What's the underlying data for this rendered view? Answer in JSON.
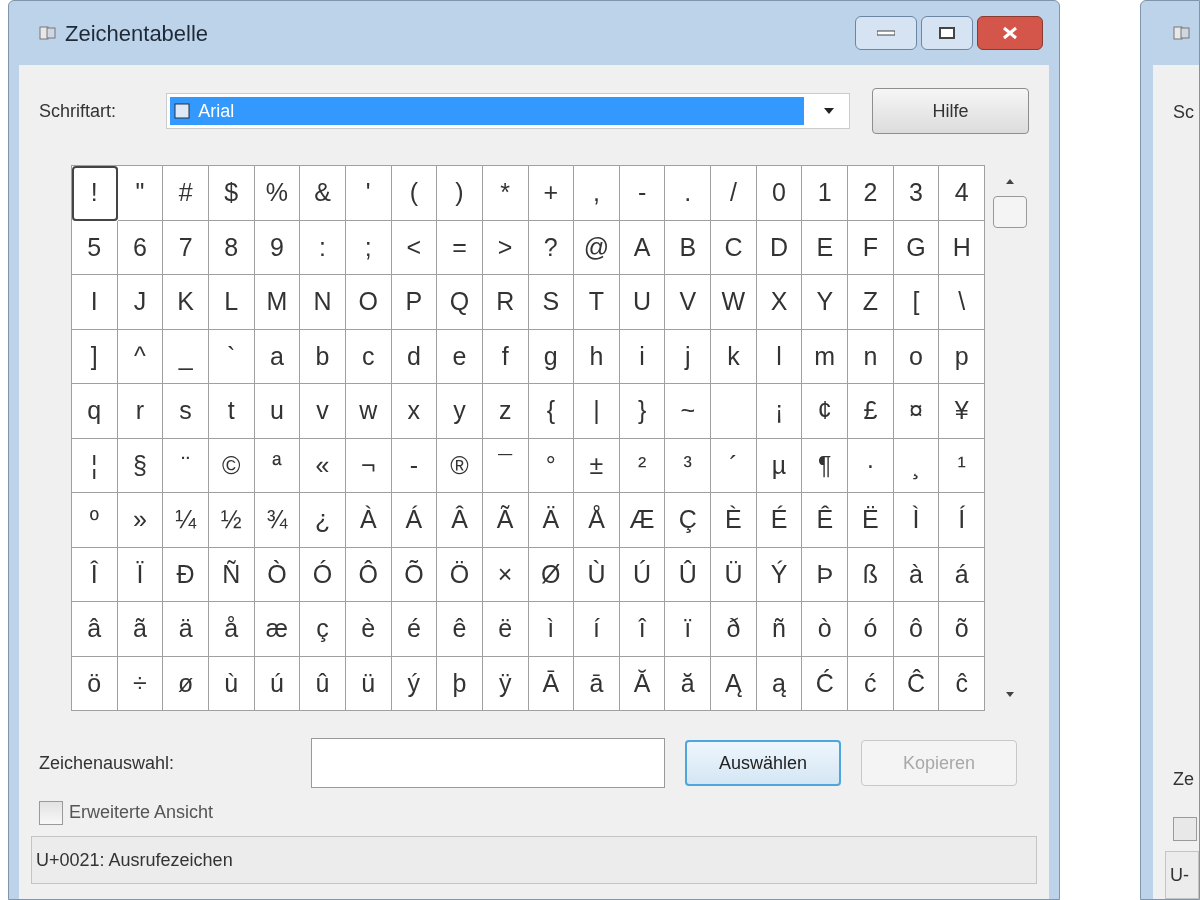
{
  "window": {
    "title": "Zeichentabelle"
  },
  "font_row": {
    "label": "Schriftart:",
    "value": "Arial",
    "help_button": "Hilfe"
  },
  "grid": {
    "rows": [
      [
        {
          "c": "!",
          "selected": true
        },
        {
          "c": "\"",
          "selected": false
        },
        {
          "c": "#",
          "selected": false
        },
        {
          "c": "$",
          "selected": false
        },
        {
          "c": "%",
          "selected": false
        },
        {
          "c": "&",
          "selected": false
        },
        {
          "c": "'",
          "selected": false
        },
        {
          "c": "(",
          "selected": false
        },
        {
          "c": ")",
          "selected": false
        },
        {
          "c": "*",
          "selected": false
        },
        {
          "c": "+",
          "selected": false
        },
        {
          "c": ",",
          "selected": false
        },
        {
          "c": "-",
          "selected": false
        },
        {
          "c": ".",
          "selected": false
        },
        {
          "c": "/",
          "selected": false
        },
        {
          "c": "0",
          "selected": false
        },
        {
          "c": "1",
          "selected": false
        },
        {
          "c": "2",
          "selected": false
        },
        {
          "c": "3",
          "selected": false
        },
        {
          "c": "4",
          "selected": false
        }
      ],
      [
        {
          "c": "5",
          "selected": false
        },
        {
          "c": "6",
          "selected": false
        },
        {
          "c": "7",
          "selected": false
        },
        {
          "c": "8",
          "selected": false
        },
        {
          "c": "9",
          "selected": false
        },
        {
          "c": ":",
          "selected": false
        },
        {
          "c": ";",
          "selected": false
        },
        {
          "c": "<",
          "selected": false
        },
        {
          "c": "=",
          "selected": false
        },
        {
          "c": ">",
          "selected": false
        },
        {
          "c": "?",
          "selected": false
        },
        {
          "c": "@",
          "selected": false
        },
        {
          "c": "A",
          "selected": false
        },
        {
          "c": "B",
          "selected": false
        },
        {
          "c": "C",
          "selected": false
        },
        {
          "c": "D",
          "selected": false
        },
        {
          "c": "E",
          "selected": false
        },
        {
          "c": "F",
          "selected": false
        },
        {
          "c": "G",
          "selected": false
        },
        {
          "c": "H",
          "selected": false
        }
      ],
      [
        {
          "c": "I",
          "selected": false
        },
        {
          "c": "J",
          "selected": false
        },
        {
          "c": "K",
          "selected": false
        },
        {
          "c": "L",
          "selected": false
        },
        {
          "c": "M",
          "selected": false
        },
        {
          "c": "N",
          "selected": false
        },
        {
          "c": "O",
          "selected": false
        },
        {
          "c": "P",
          "selected": false
        },
        {
          "c": "Q",
          "selected": false
        },
        {
          "c": "R",
          "selected": false
        },
        {
          "c": "S",
          "selected": false
        },
        {
          "c": "T",
          "selected": false
        },
        {
          "c": "U",
          "selected": false
        },
        {
          "c": "V",
          "selected": false
        },
        {
          "c": "W",
          "selected": false
        },
        {
          "c": "X",
          "selected": false
        },
        {
          "c": "Y",
          "selected": false
        },
        {
          "c": "Z",
          "selected": false
        },
        {
          "c": "[",
          "selected": false
        },
        {
          "c": "\\",
          "selected": false
        }
      ],
      [
        {
          "c": "]",
          "selected": false
        },
        {
          "c": "^",
          "selected": false
        },
        {
          "c": "_",
          "selected": false
        },
        {
          "c": "`",
          "selected": false
        },
        {
          "c": "a",
          "selected": false
        },
        {
          "c": "b",
          "selected": false
        },
        {
          "c": "c",
          "selected": false
        },
        {
          "c": "d",
          "selected": false
        },
        {
          "c": "e",
          "selected": false
        },
        {
          "c": "f",
          "selected": false
        },
        {
          "c": "g",
          "selected": false
        },
        {
          "c": "h",
          "selected": false
        },
        {
          "c": "i",
          "selected": false
        },
        {
          "c": "j",
          "selected": false
        },
        {
          "c": "k",
          "selected": false
        },
        {
          "c": "l",
          "selected": false
        },
        {
          "c": "m",
          "selected": false
        },
        {
          "c": "n",
          "selected": false
        },
        {
          "c": "o",
          "selected": false
        },
        {
          "c": "p",
          "selected": false
        }
      ],
      [
        {
          "c": "q",
          "selected": false
        },
        {
          "c": "r",
          "selected": false
        },
        {
          "c": "s",
          "selected": false
        },
        {
          "c": "t",
          "selected": false
        },
        {
          "c": "u",
          "selected": false
        },
        {
          "c": "v",
          "selected": false
        },
        {
          "c": "w",
          "selected": false
        },
        {
          "c": "x",
          "selected": false
        },
        {
          "c": "y",
          "selected": false
        },
        {
          "c": "z",
          "selected": false
        },
        {
          "c": "{",
          "selected": false
        },
        {
          "c": "|",
          "selected": false
        },
        {
          "c": "}",
          "selected": false
        },
        {
          "c": "~",
          "selected": false
        },
        {
          "selected": false
        },
        {
          "c": "¡",
          "selected": false
        },
        {
          "c": "¢",
          "selected": false
        },
        {
          "c": "£",
          "selected": false
        },
        {
          "c": "¤",
          "selected": false
        },
        {
          "c": "¥",
          "selected": false
        }
      ],
      [
        {
          "c": "¦",
          "selected": false
        },
        {
          "c": "§",
          "selected": false
        },
        {
          "c": "¨",
          "selected": false
        },
        {
          "c": "©",
          "selected": false
        },
        {
          "c": "ª",
          "selected": false
        },
        {
          "c": "«",
          "selected": false
        },
        {
          "c": "¬",
          "selected": false
        },
        {
          "c": "-",
          "selected": false
        },
        {
          "c": "®",
          "selected": false
        },
        {
          "c": "¯",
          "selected": false
        },
        {
          "c": "°",
          "selected": false
        },
        {
          "c": "±",
          "selected": false
        },
        {
          "c": "²",
          "selected": false
        },
        {
          "c": "³",
          "selected": false
        },
        {
          "c": "´",
          "selected": false
        },
        {
          "c": "µ",
          "selected": false
        },
        {
          "c": "¶",
          "selected": false
        },
        {
          "c": "·",
          "selected": false
        },
        {
          "c": "¸",
          "selected": false
        },
        {
          "c": "¹",
          "selected": false
        }
      ],
      [
        {
          "c": "º",
          "selected": false
        },
        {
          "c": "»",
          "selected": false
        },
        {
          "c": "¼",
          "selected": false
        },
        {
          "c": "½",
          "selected": false
        },
        {
          "c": "¾",
          "selected": false
        },
        {
          "c": "¿",
          "selected": false
        },
        {
          "c": "À",
          "selected": false
        },
        {
          "c": "Á",
          "selected": false
        },
        {
          "c": "Â",
          "selected": false
        },
        {
          "c": "Ã",
          "selected": false
        },
        {
          "c": "Ä",
          "selected": false
        },
        {
          "c": "Å",
          "selected": false
        },
        {
          "c": "Æ",
          "selected": false
        },
        {
          "c": "Ç",
          "selected": false
        },
        {
          "c": "È",
          "selected": false
        },
        {
          "c": "É",
          "selected": false
        },
        {
          "c": "Ê",
          "selected": false
        },
        {
          "c": "Ë",
          "selected": false
        },
        {
          "c": "Ì",
          "selected": false
        },
        {
          "c": "Í",
          "selected": false
        }
      ],
      [
        {
          "c": "Î",
          "selected": false
        },
        {
          "c": "Ï",
          "selected": false
        },
        {
          "c": "Ð",
          "selected": false
        },
        {
          "c": "Ñ",
          "selected": false
        },
        {
          "c": "Ò",
          "selected": false
        },
        {
          "c": "Ó",
          "selected": false
        },
        {
          "c": "Ô",
          "selected": false
        },
        {
          "c": "Õ",
          "selected": false
        },
        {
          "c": "Ö",
          "selected": false
        },
        {
          "c": "×",
          "selected": false
        },
        {
          "c": "Ø",
          "selected": false
        },
        {
          "c": "Ù",
          "selected": false
        },
        {
          "c": "Ú",
          "selected": false
        },
        {
          "c": "Û",
          "selected": false
        },
        {
          "c": "Ü",
          "selected": false
        },
        {
          "c": "Ý",
          "selected": false
        },
        {
          "c": "Þ",
          "selected": false
        },
        {
          "c": "ß",
          "selected": false
        },
        {
          "c": "à",
          "selected": false
        },
        {
          "c": "á",
          "selected": false
        }
      ],
      [
        {
          "c": "â",
          "selected": false
        },
        {
          "c": "ã",
          "selected": false
        },
        {
          "c": "ä",
          "selected": false
        },
        {
          "c": "å",
          "selected": false
        },
        {
          "c": "æ",
          "selected": false
        },
        {
          "c": "ç",
          "selected": false
        },
        {
          "c": "è",
          "selected": false
        },
        {
          "c": "é",
          "selected": false
        },
        {
          "c": "ê",
          "selected": false
        },
        {
          "c": "ë",
          "selected": false
        },
        {
          "c": "ì",
          "selected": false
        },
        {
          "c": "í",
          "selected": false
        },
        {
          "c": "î",
          "selected": false
        },
        {
          "c": "ï",
          "selected": false
        },
        {
          "c": "ð",
          "selected": false
        },
        {
          "c": "ñ",
          "selected": false
        },
        {
          "c": "ò",
          "selected": false
        },
        {
          "c": "ó",
          "selected": false
        },
        {
          "c": "ô",
          "selected": false
        },
        {
          "c": "õ",
          "selected": false
        }
      ],
      [
        {
          "c": "ö",
          "selected": false
        },
        {
          "c": "÷",
          "selected": false
        },
        {
          "c": "ø",
          "selected": false
        },
        {
          "c": "ù",
          "selected": false
        },
        {
          "c": "ú",
          "selected": false
        },
        {
          "c": "û",
          "selected": false
        },
        {
          "c": "ü",
          "selected": false
        },
        {
          "c": "ý",
          "selected": false
        },
        {
          "c": "þ",
          "selected": false
        },
        {
          "c": "ÿ",
          "selected": false
        },
        {
          "c": "Ā",
          "selected": false
        },
        {
          "c": "ā",
          "selected": false
        },
        {
          "c": "Ă",
          "selected": false
        },
        {
          "c": "ă",
          "selected": false
        },
        {
          "c": "Ą",
          "selected": false
        },
        {
          "c": "ą",
          "selected": false
        },
        {
          "c": "Ć",
          "selected": false
        },
        {
          "c": "ć",
          "selected": false
        },
        {
          "c": "Ĉ",
          "selected": false
        },
        {
          "c": "ĉ",
          "selected": false
        }
      ]
    ]
  },
  "selection": {
    "label": "Zeichenauswahl:",
    "select_button": "Auswählen",
    "copy_button": {
      "label": "Kopieren",
      "disabled": true
    }
  },
  "advanced_view": {
    "label": "Erweiterte Ansicht",
    "checked": false
  },
  "status_bar": "U+0021: Ausrufezeichen",
  "second_window": {
    "font_label": "Sc",
    "selection_label": "Ze",
    "checkbox_checked": false,
    "status_bar": "U-"
  }
}
